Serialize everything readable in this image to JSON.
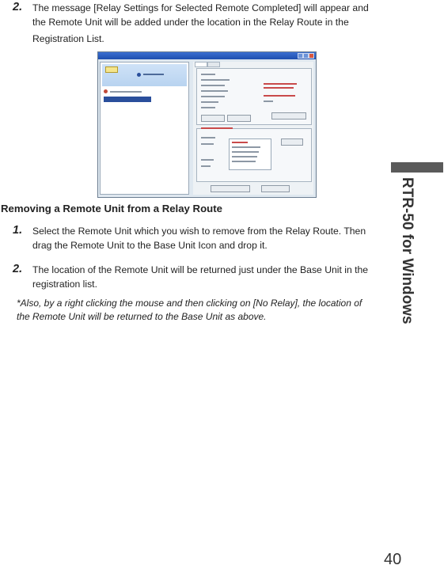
{
  "step_top": {
    "number": "2.",
    "text_line1": "The message [Relay Settings for Selected Remote Completed] will appear and",
    "text_line2": "the Remote Unit will be added under the location in the Relay Route in the",
    "text_line3": "Registration List."
  },
  "section_heading": "Removing a Remote Unit from a Relay Route",
  "steps": [
    {
      "number": "1.",
      "text_line1": "Select the Remote Unit which you wish to remove from the Relay Route. Then",
      "text_line2": "drag the Remote Unit to the Base Unit Icon and drop it."
    },
    {
      "number": "2.",
      "text_line1": "The location of the Remote Unit will be returned just under the Base Unit in the",
      "text_line2": "registration list."
    }
  ],
  "note": {
    "line1": "*Also, by a right clicking the mouse and then clicking on [No Relay], the location of",
    "line2": "the Remote Unit will be returned to the Base Unit as above."
  },
  "side_title": "RTR-50 for Windows",
  "page_number": "40"
}
